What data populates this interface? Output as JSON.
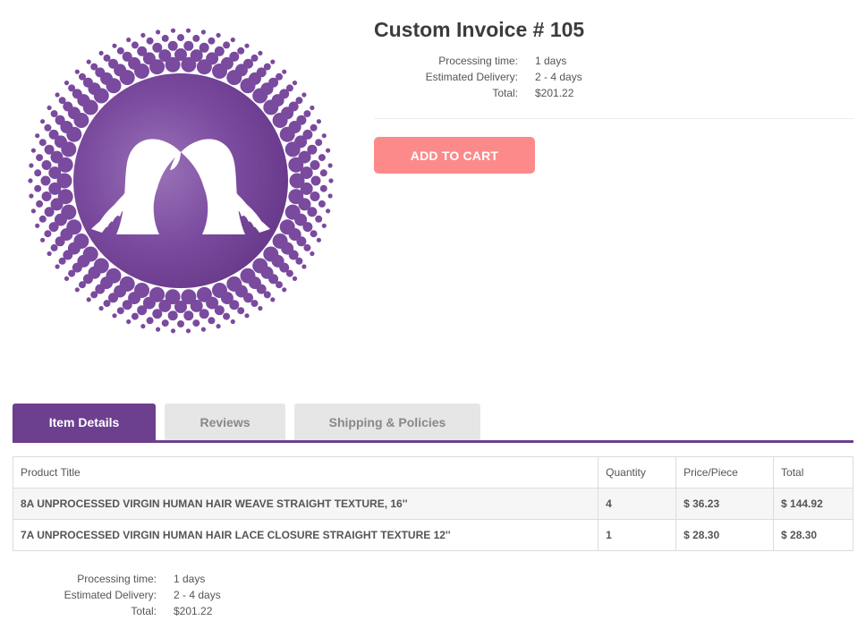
{
  "invoice": {
    "title": "Custom Invoice # 105",
    "summary": [
      {
        "label": "Processing time:",
        "value": "1 days"
      },
      {
        "label": "Estimated Delivery:",
        "value": "2 - 4 days"
      },
      {
        "label": "Total:",
        "value": "$201.22"
      }
    ]
  },
  "actions": {
    "add_to_cart": "ADD TO CART"
  },
  "tabs": [
    {
      "label": "Item Details",
      "active": true
    },
    {
      "label": "Reviews",
      "active": false
    },
    {
      "label": "Shipping & Policies",
      "active": false
    }
  ],
  "table": {
    "headers": [
      "Product Title",
      "Quantity",
      "Price/Piece",
      "Total"
    ],
    "rows": [
      [
        "8A UNPROCESSED VIRGIN HUMAN HAIR WEAVE STRAIGHT TEXTURE, 16''",
        "4",
        "$ 36.23",
        "$ 144.92"
      ],
      [
        "7A UNPROCESSED VIRGIN HUMAN HAIR LACE CLOSURE STRAIGHT TEXTURE 12''",
        "1",
        "$ 28.30",
        "$ 28.30"
      ]
    ]
  },
  "footer_summary": [
    {
      "label": "Processing time:",
      "value": "1 days"
    },
    {
      "label": "Estimated Delivery:",
      "value": "2 - 4 days"
    },
    {
      "label": "Total:",
      "value": "$201.22"
    }
  ],
  "colors": {
    "brand_purple": "#6d3f8f",
    "button_coral": "#fd8a8b",
    "tab_inactive": "#e6e6e6"
  },
  "icons": {
    "product_image": "hair-silhouette-logo-icon"
  }
}
